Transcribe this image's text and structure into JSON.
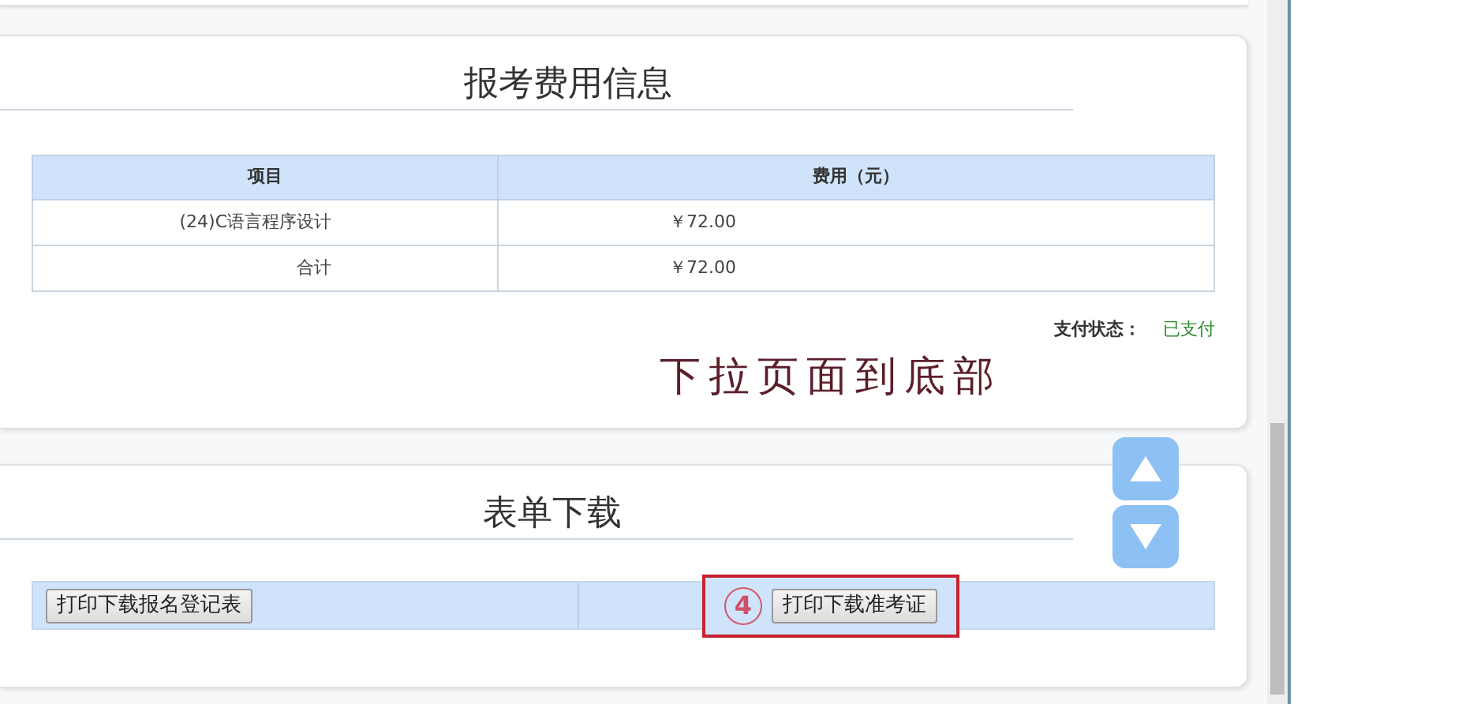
{
  "fee_section": {
    "title": "报考费用信息",
    "table": {
      "columns": [
        "项目",
        "费用（元）"
      ],
      "rows": [
        [
          "(24)C语言程序设计",
          "￥72.00"
        ],
        [
          "合计",
          "￥72.00"
        ]
      ]
    },
    "payment_status": {
      "label": "支付状态：",
      "value": "已支付"
    }
  },
  "annotation": "下拉页面到底部",
  "download_section": {
    "title": "表单下载",
    "buttons": [
      {
        "label": "打印下载报名登记表",
        "highlighted": false
      },
      {
        "label": "打印下载准考证",
        "highlighted": true,
        "step": "4"
      }
    ]
  }
}
